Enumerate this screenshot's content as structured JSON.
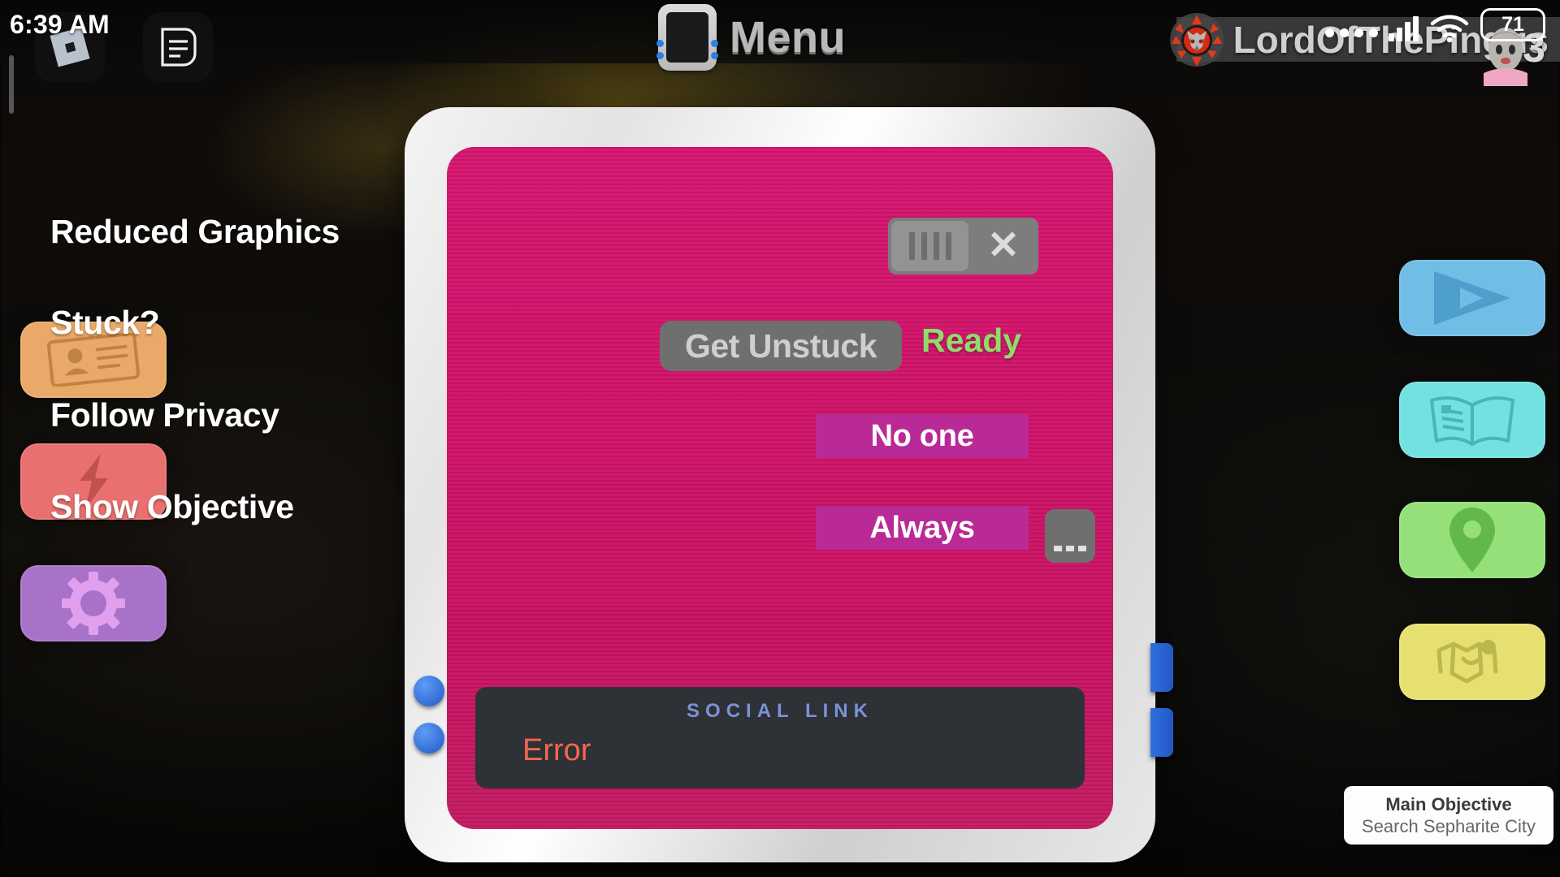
{
  "statusbar": {
    "time": "6:39 AM",
    "signal_dots": 4,
    "signal_bars": [
      10,
      16,
      22,
      28
    ],
    "wifi_icon": "wifi-icon",
    "battery_level": "71"
  },
  "topbar": {
    "roblox_icon": "roblox-logo-icon",
    "chat_icon": "chat-document-icon",
    "menu_icon": "menu-panel-icon",
    "title": "Menu",
    "player_name": "LordOfThePingus",
    "player_avatar_icon": "fox-avatar-icon",
    "player_count": "53"
  },
  "left_sidebar": {
    "items": [
      {
        "name": "profile-card-button",
        "icon": "id-card-icon",
        "color": "#eaa968"
      },
      {
        "name": "power-button",
        "icon": "lightning-bolt-icon",
        "color": "#e8706e"
      },
      {
        "name": "settings-button",
        "icon": "gear-icon",
        "color": "#a872c8"
      }
    ]
  },
  "right_sidebar": {
    "items": [
      {
        "name": "play-button",
        "icon": "play-triangle-icon",
        "color": "#70bde6"
      },
      {
        "name": "book-button",
        "icon": "open-book-icon",
        "color": "#73e0e2"
      },
      {
        "name": "map-button",
        "icon": "map-pin-icon",
        "color": "#96e07a"
      },
      {
        "name": "trade-button",
        "icon": "handshake-icon",
        "color": "#e6e071"
      }
    ]
  },
  "menu_panel": {
    "accent_pink": "#cf1268",
    "rows": {
      "graphics": {
        "label": "Reduced Graphics",
        "toggle_state": "off",
        "toggle_off_glyph": "✕"
      },
      "stuck": {
        "label": "Stuck?",
        "button_label": "Get Unstuck",
        "status": "Ready",
        "status_color": "#8ede6a"
      },
      "privacy": {
        "label": "Follow Privacy",
        "value": "No one"
      },
      "objective": {
        "label": "Show Objective",
        "value": "Always",
        "more_icon": "ellipsis-icon"
      }
    },
    "social_link": {
      "title": "SOCIAL LINK",
      "value": "Error",
      "value_color": "#f4664e"
    }
  },
  "objective_toast": {
    "title": "Main Objective",
    "subtitle": "Search Sepharite City"
  }
}
